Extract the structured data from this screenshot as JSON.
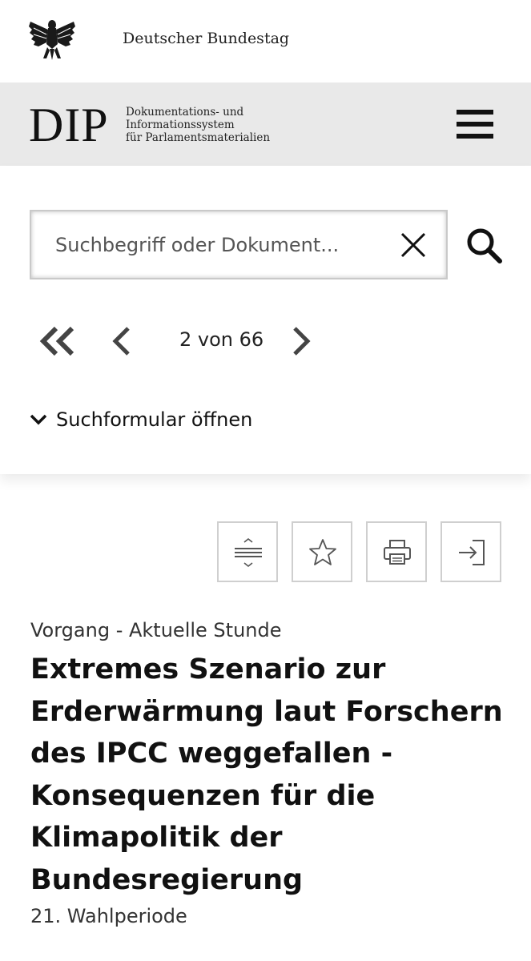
{
  "header": {
    "institution": "Deutscher Bundestag",
    "logo_icon": "federal-eagle-icon"
  },
  "dip": {
    "logo_text": "DIP",
    "subtitle_line1": "Dokumentations- und",
    "subtitle_line2": "Informationssystem",
    "subtitle_line3": "für Parlamentsmaterialien",
    "menu_icon": "hamburger-menu-icon"
  },
  "search": {
    "placeholder": "Suchbegriff oder Dokument...",
    "value": "",
    "clear_icon": "close-icon",
    "submit_icon": "search-icon"
  },
  "pager": {
    "text": "2 von 66",
    "first_icon": "double-chevron-left-icon",
    "prev_icon": "chevron-left-icon",
    "next_icon": "chevron-right-icon"
  },
  "search_form_toggle": {
    "label": "Suchformular öffnen",
    "icon": "chevron-down-icon"
  },
  "toolbar": {
    "buttons": [
      {
        "icon": "expand-collapse-icon"
      },
      {
        "icon": "star-icon"
      },
      {
        "icon": "print-icon"
      },
      {
        "icon": "export-icon"
      }
    ]
  },
  "document": {
    "category": "Vorgang - Aktuelle Stunde",
    "title": "Extremes Szenario zur Erderwärmung laut Forschern des IPCC weggefallen - Konsequenzen für die Klimapolitik der Bundesregierung",
    "period": "21. Wahlperiode"
  }
}
